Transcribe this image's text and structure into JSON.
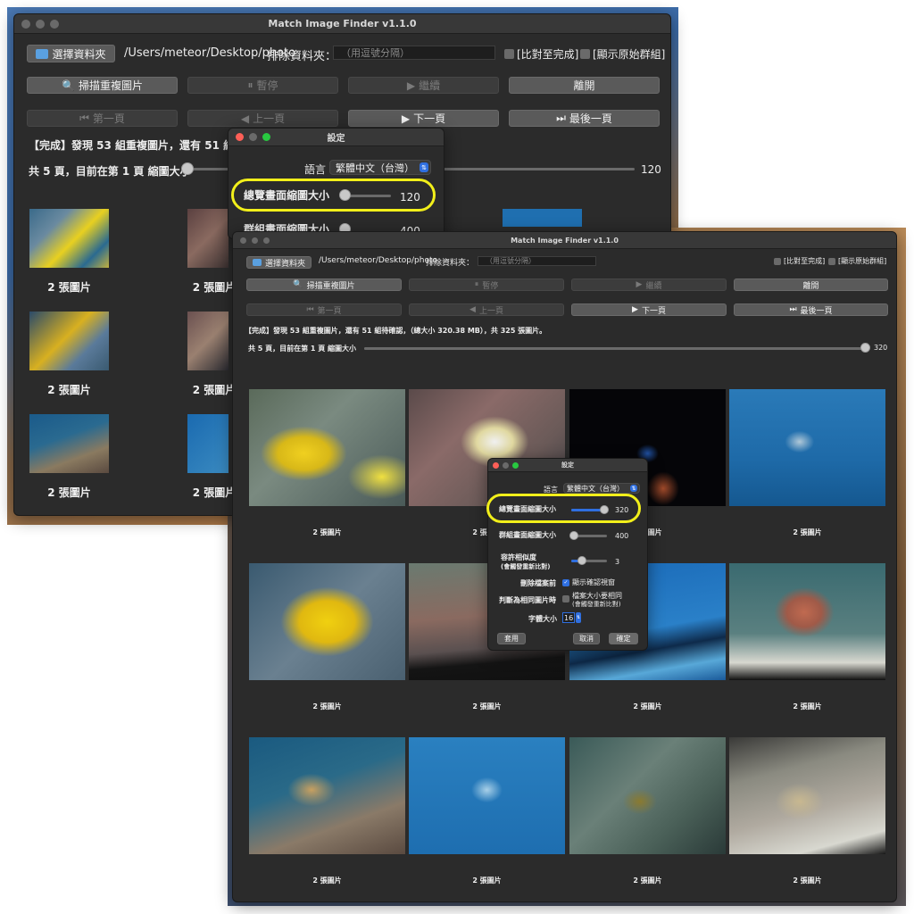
{
  "app": {
    "title": "Match Image Finder v1.1.0"
  },
  "toolbar": {
    "choose_folder": "選擇資料夾",
    "folder_path": "/Users/meteor/Desktop/photo",
    "exclude_label": "排除資料夾：",
    "exclude_placeholder": "（用逗號分隔）",
    "compare_to_end": "[比對至完成]",
    "show_original_group": "[顯示原始群組]"
  },
  "actions": {
    "scan": "掃描重複圖片",
    "pause": "暫停",
    "resume": "繼續",
    "leave": "離開"
  },
  "paging": {
    "first": "第一頁",
    "prev": "上一頁",
    "next": "下一頁",
    "last": "最後一頁"
  },
  "back_window": {
    "status": "【完成】發現 53 組重複圖片，還有 51 組待確認",
    "page_info": "共 5 頁，目前在第 1 頁  縮圖大小",
    "thumb_size": "120",
    "thumb_size_fraction": 0.0,
    "captions": [
      "2 張圖片",
      "2 張圖片",
      "2 張圖片",
      "2 張圖片",
      "2 張圖片",
      "2 張圖片"
    ]
  },
  "back_dialog": {
    "title": "設定",
    "language_label": "語言",
    "language_value": "繁體中文（台灣）",
    "overview_label": "總覽畫面縮圖大小",
    "overview_value": "120",
    "group_label_partial": "群組畫面縮圖大小",
    "group_value_partial": "400"
  },
  "front_window": {
    "status": "【完成】發現 53 組重複圖片，還有 51 組待確認，（總大小 320.38 MB），共 325 張圖片。",
    "page_info": "共 5 頁，目前在第 1 頁  縮圖大小",
    "thumb_size": "320",
    "thumb_size_fraction": 1.0,
    "captions": [
      "2 張圖片",
      "2 張圖片",
      "2 張圖片",
      "2 張圖片",
      "2 張圖片",
      "2 張圖片",
      "2 張圖片",
      "2 張圖片",
      "2 張圖片",
      "2 張圖片",
      "2 張圖片",
      "2 張圖片"
    ]
  },
  "front_dialog": {
    "title": "設定",
    "language_label": "語言",
    "language_value": "繁體中文（台灣）",
    "overview_label": "總覽畫面縮圖大小",
    "overview_value": "320",
    "overview_fraction": 1.0,
    "group_label": "群組畫面縮圖大小",
    "group_value": "400",
    "group_fraction": 0.0,
    "similarity_label_1": "容許相似度",
    "similarity_label_2": "(會觸發重新比對)",
    "similarity_value": "3",
    "similarity_fraction": 0.3,
    "delete_label": "刪除檔案前",
    "delete_check": "顯示確認視窗",
    "same_label": "判斷為相同圖片時",
    "same_check_1": "檔案大小要相同",
    "same_check_2": "(會觸發重新比對)",
    "font_label": "字體大小",
    "font_value": "16",
    "apply": "套用",
    "cancel": "取消",
    "ok": "確定"
  },
  "colors": {
    "accent": "#2f6fe0",
    "highlight": "#f2ef1a",
    "window": "#2b2b2b"
  },
  "icons": [
    "folder-icon",
    "magnifier-icon",
    "pause-icon",
    "play-icon",
    "first-page-icon",
    "prev-page-icon",
    "next-page-icon",
    "last-page-icon"
  ]
}
